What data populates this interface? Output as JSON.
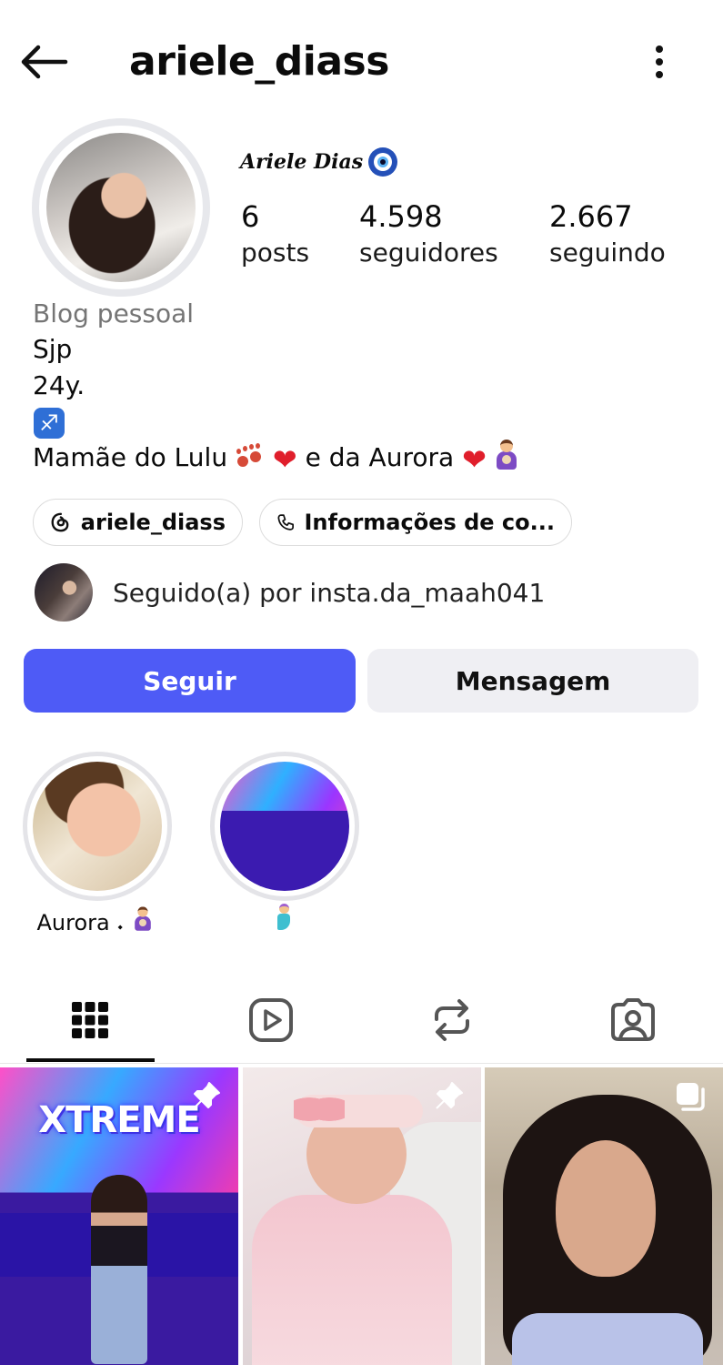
{
  "header": {
    "username": "ariele_diass"
  },
  "profile": {
    "display_name": "Ariele Dias",
    "stats": [
      {
        "value": "6",
        "label": "posts"
      },
      {
        "value": "4.598",
        "label": "seguidores"
      },
      {
        "value": "2.667",
        "label": "seguindo"
      }
    ],
    "category": "Blog pessoal",
    "bio": {
      "line1": "Sjp",
      "line2": "24y.",
      "line3_icon": "♐",
      "line4_part1": "Mamãe do Lulu",
      "line4_part2": "e da Aurora",
      "heart": "❤"
    },
    "chips": [
      {
        "label": "ariele_diass",
        "icon": "threads-icon"
      },
      {
        "label": "Informações de co...",
        "icon": "phone-icon"
      }
    ],
    "followed_by": "Seguido(a) por insta.da_maah041"
  },
  "actions": {
    "follow": "Seguir",
    "message": "Mensagem"
  },
  "highlights": [
    {
      "label": "Aurora 𝆺"
    },
    {
      "label": ""
    }
  ],
  "tabs": [
    {
      "icon": "grid-icon",
      "active": true
    },
    {
      "icon": "reels-icon",
      "active": false
    },
    {
      "icon": "reposts-icon",
      "active": false
    },
    {
      "icon": "tagged-icon",
      "active": false
    }
  ],
  "posts": [
    {
      "sign_text": "XTREME",
      "badge": "pin-icon"
    },
    {
      "badge": "pin-icon"
    },
    {
      "badge": "carousel-icon"
    }
  ],
  "colors": {
    "follow_button": "#4e5bf6",
    "message_button": "#efeff3",
    "category_text": "#757575"
  }
}
